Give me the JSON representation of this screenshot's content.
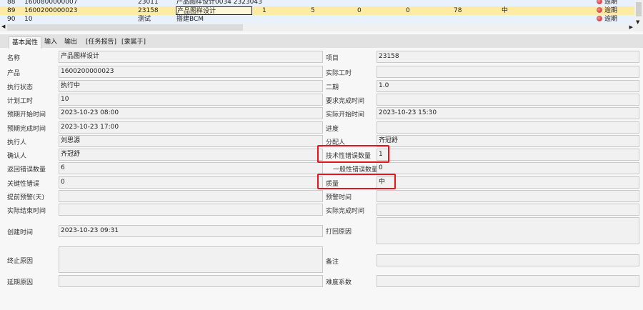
{
  "table": {
    "rows": [
      {
        "no": "88",
        "code": "1600800000007",
        "project": "23011",
        "name": "产品图样设计0034 2323043",
        "c1": "",
        "c2": "",
        "c3": "",
        "c4": "",
        "c5": "",
        "quality": "",
        "status": "逾期"
      },
      {
        "no": "89",
        "code": "1600200000023",
        "project": "23158",
        "name": "产品图样设计",
        "c1": "1",
        "c2": "5",
        "c3": "0",
        "c4": "0",
        "c5": "78",
        "quality": "中",
        "status": "逾期"
      },
      {
        "no": "90",
        "code": "10",
        "project": "测试",
        "name": "搭建BCM",
        "c1": "",
        "c2": "",
        "c3": "",
        "c4": "",
        "c5": "",
        "quality": "",
        "status": "逾期"
      }
    ]
  },
  "tabs": [
    "基本属性",
    "输入",
    "输出",
    "[任务报告]",
    "[隶属于]"
  ],
  "form": {
    "left": [
      {
        "label": "名称",
        "value": "产品图样设计"
      },
      {
        "label": "产品",
        "value": "1600200000023"
      },
      {
        "label": "执行状态",
        "value": "执行中"
      },
      {
        "label": "计划工时",
        "value": "10"
      },
      {
        "label": "预期开始时间",
        "value": "2023-10-23 08:00"
      },
      {
        "label": "预期完成时间",
        "value": "2023-10-23 17:00"
      },
      {
        "label": "执行人",
        "value": "刘思源"
      },
      {
        "label": "确认人",
        "value": "齐冠舒"
      },
      {
        "label": "返回错误数量",
        "value": "6"
      },
      {
        "label": "关键性错误",
        "value": "0"
      },
      {
        "label": "提前预警(天)",
        "value": ""
      },
      {
        "label": "实际结束时间",
        "value": ""
      },
      {
        "label": "创建时间",
        "value": "2023-10-23 09:31"
      },
      {
        "label": "终止原因",
        "value": ""
      },
      {
        "label": "延期原因",
        "value": ""
      }
    ],
    "right": [
      {
        "label": "项目",
        "value": "23158"
      },
      {
        "label": "实际工时",
        "value": ""
      },
      {
        "label": "二期",
        "value": "1.0"
      },
      {
        "label": "要求完成时间",
        "value": ""
      },
      {
        "label": "实际开始时间",
        "value": "2023-10-23 15:30"
      },
      {
        "label": "进度",
        "value": ""
      },
      {
        "label": "分配人",
        "value": "齐冠舒"
      },
      {
        "label": "技术性错误数量",
        "value": "1"
      },
      {
        "label": "一般性错误数量",
        "value": "0"
      },
      {
        "label": "质量",
        "value": "中"
      },
      {
        "label": "预警时间",
        "value": ""
      },
      {
        "label": "实际完成时间",
        "value": ""
      },
      {
        "label": "打回原因",
        "value": ""
      },
      {
        "label": "备注",
        "value": ""
      },
      {
        "label": "难度系数",
        "value": ""
      }
    ]
  },
  "colors": {
    "highlight": "#e8141c",
    "selected_row": "#fdeba6"
  }
}
